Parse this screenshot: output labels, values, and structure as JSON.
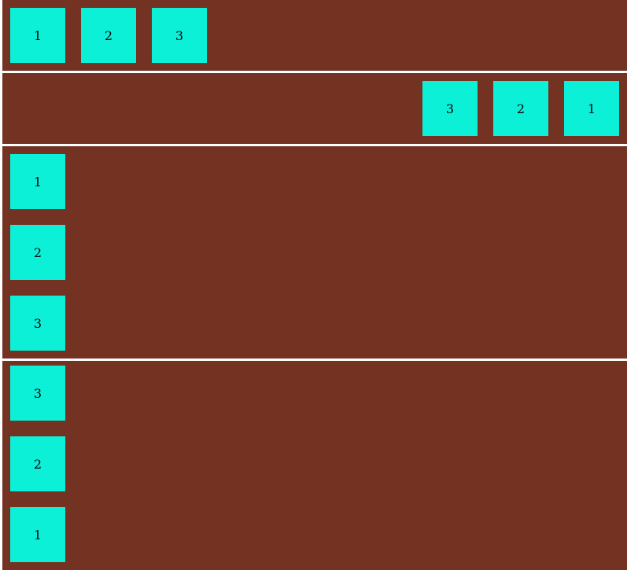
{
  "colors": {
    "panel_background": "#743322",
    "box_background": "#0cf0d8",
    "separator": "#ffffff"
  },
  "panels": [
    {
      "direction": "row",
      "items": [
        "1",
        "2",
        "3"
      ]
    },
    {
      "direction": "row-reverse",
      "items": [
        "1",
        "2",
        "3"
      ]
    },
    {
      "direction": "column",
      "items": [
        "1",
        "2",
        "3"
      ]
    },
    {
      "direction": "column-reverse",
      "items": [
        "1",
        "2",
        "3"
      ]
    }
  ]
}
